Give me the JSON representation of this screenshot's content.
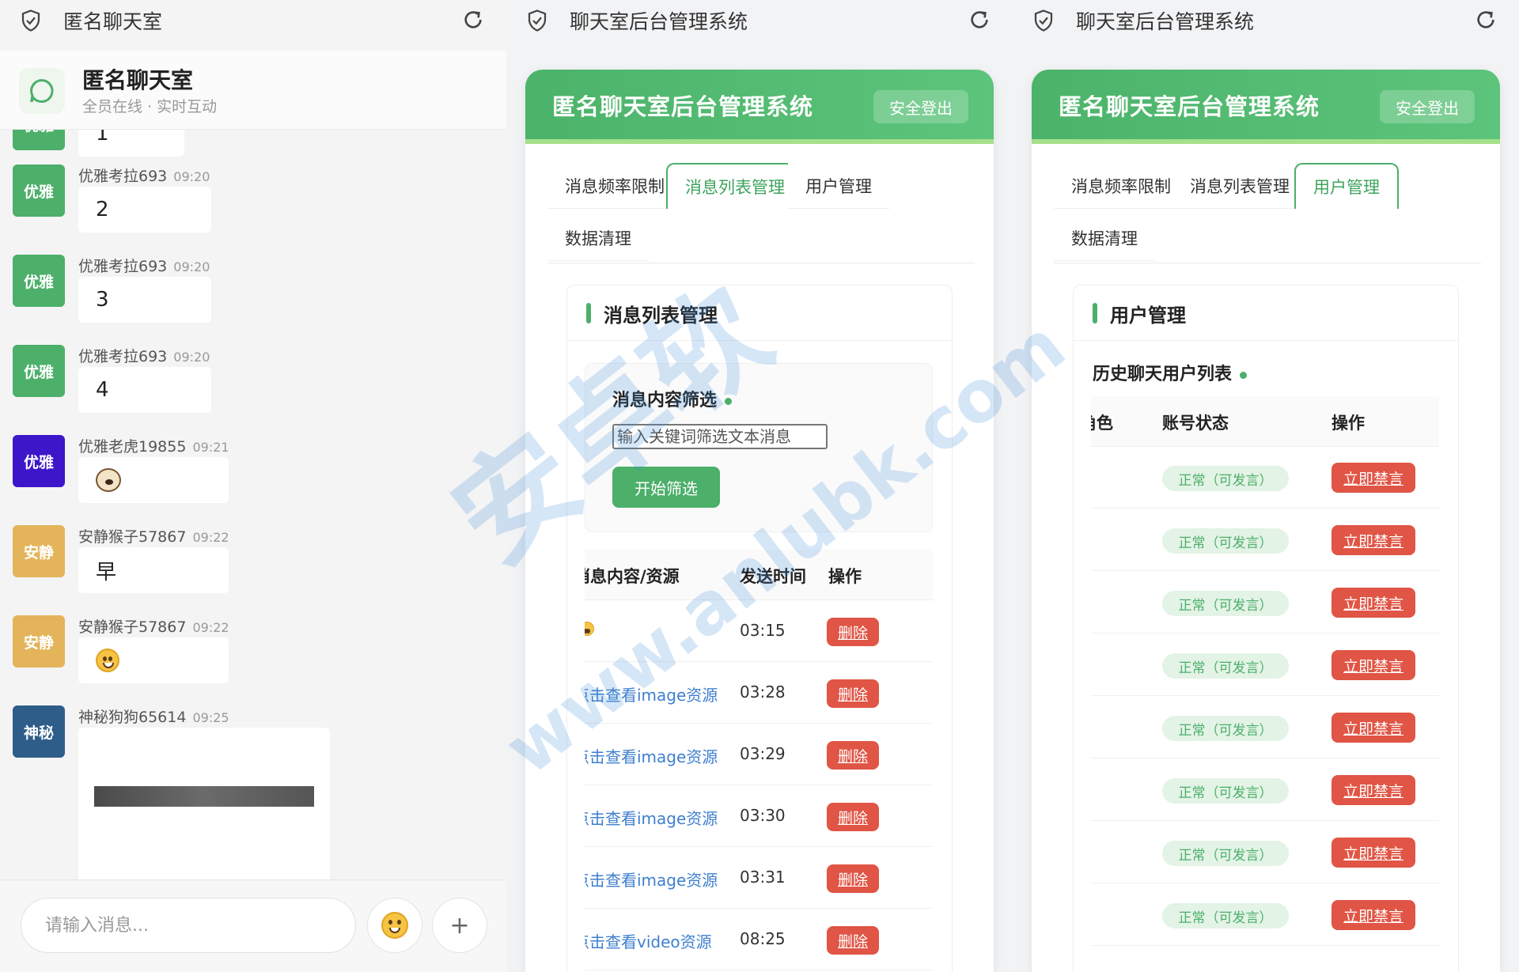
{
  "chat_panel": {
    "browser_title": "匿名聊天室",
    "header_title": "匿名聊天室",
    "header_subtitle": "全员在线 · 实时互动",
    "input_placeholder": "请输入消息...",
    "plus_label": "+",
    "messages": [
      {
        "avatar": "优雅",
        "avatar_color": "#4caf6a",
        "name": "",
        "time": "",
        "text": "1"
      },
      {
        "avatar": "优雅",
        "avatar_color": "#4caf6a",
        "name": "优雅考拉693",
        "time": "09:20",
        "text": "2"
      },
      {
        "avatar": "优雅",
        "avatar_color": "#4caf6a",
        "name": "优雅考拉693",
        "time": "09:20",
        "text": "3"
      },
      {
        "avatar": "优雅",
        "avatar_color": "#4caf6a",
        "name": "优雅考拉693",
        "time": "09:20",
        "text": "4"
      },
      {
        "avatar": "优雅",
        "avatar_color": "#3d16c9",
        "name": "优雅老虎19855",
        "time": "09:21",
        "content": "dog-emoji"
      },
      {
        "avatar": "安静",
        "avatar_color": "#e3b45a",
        "name": "安静猴子57867",
        "time": "09:22",
        "text": "早"
      },
      {
        "avatar": "安静",
        "avatar_color": "#e3b45a",
        "name": "安静猴子57867",
        "time": "09:22",
        "content": "smile-emoji"
      },
      {
        "avatar": "神秘",
        "avatar_color": "#2f5d8a",
        "name": "神秘狗狗65614",
        "time": "09:25",
        "content": "image"
      }
    ]
  },
  "admin_msg_panel": {
    "browser_title": "聊天室后台管理系统",
    "admin_title": "匿名聊天室后台管理系统",
    "logout_label": "安全登出",
    "tabs": [
      "消息频率限制",
      "消息列表管理",
      "用户管理",
      "数据清理"
    ],
    "active_tab": 1,
    "section_title": "消息列表管理",
    "filter_title": "消息内容筛选",
    "filter_placeholder": "输入关键词筛选文本消息",
    "filter_button": "开始筛选",
    "table_headers": [
      "消息内容/资源",
      "发送时间",
      "操作"
    ],
    "rows": [
      {
        "content": "",
        "time": "03:15",
        "action": "删除"
      },
      {
        "content": "点击查看image资源",
        "time": "03:28",
        "action": "删除"
      },
      {
        "content": "点击查看image资源",
        "time": "03:29",
        "action": "删除"
      },
      {
        "content": "点击查看image资源",
        "time": "03:30",
        "action": "删除"
      },
      {
        "content": "点击查看image资源",
        "time": "03:31",
        "action": "删除"
      },
      {
        "content": "点击查看video资源",
        "time": "08:25",
        "action": "删除"
      }
    ]
  },
  "admin_user_panel": {
    "browser_title": "聊天室后台管理系统",
    "admin_title": "匿名聊天室后台管理系统",
    "logout_label": "安全登出",
    "tabs": [
      "消息频率限制",
      "消息列表管理",
      "用户管理",
      "数据清理"
    ],
    "active_tab": 2,
    "section_title": "用户管理",
    "list_title": "历史聊天用户列表",
    "table_headers": [
      "角色",
      "账号状态",
      "操作"
    ],
    "rows": [
      {
        "status": "正常（可发言）",
        "action": "立即禁言"
      },
      {
        "status": "正常（可发言）",
        "action": "立即禁言"
      },
      {
        "status": "正常（可发言）",
        "action": "立即禁言"
      },
      {
        "status": "正常（可发言）",
        "action": "立即禁言"
      },
      {
        "status": "正常（可发言）",
        "action": "立即禁言"
      },
      {
        "status": "正常（可发言）",
        "action": "立即禁言"
      },
      {
        "status": "正常（可发言）",
        "action": "立即禁言"
      },
      {
        "status": "正常（可发言）",
        "action": "立即禁言"
      }
    ]
  },
  "watermark": {
    "main": "安卓软",
    "url": "www.anlubk.com"
  },
  "colors": {
    "brand_green": "#4caf6a",
    "danger_red": "#e05545",
    "link_blue": "#3f7fcf"
  }
}
